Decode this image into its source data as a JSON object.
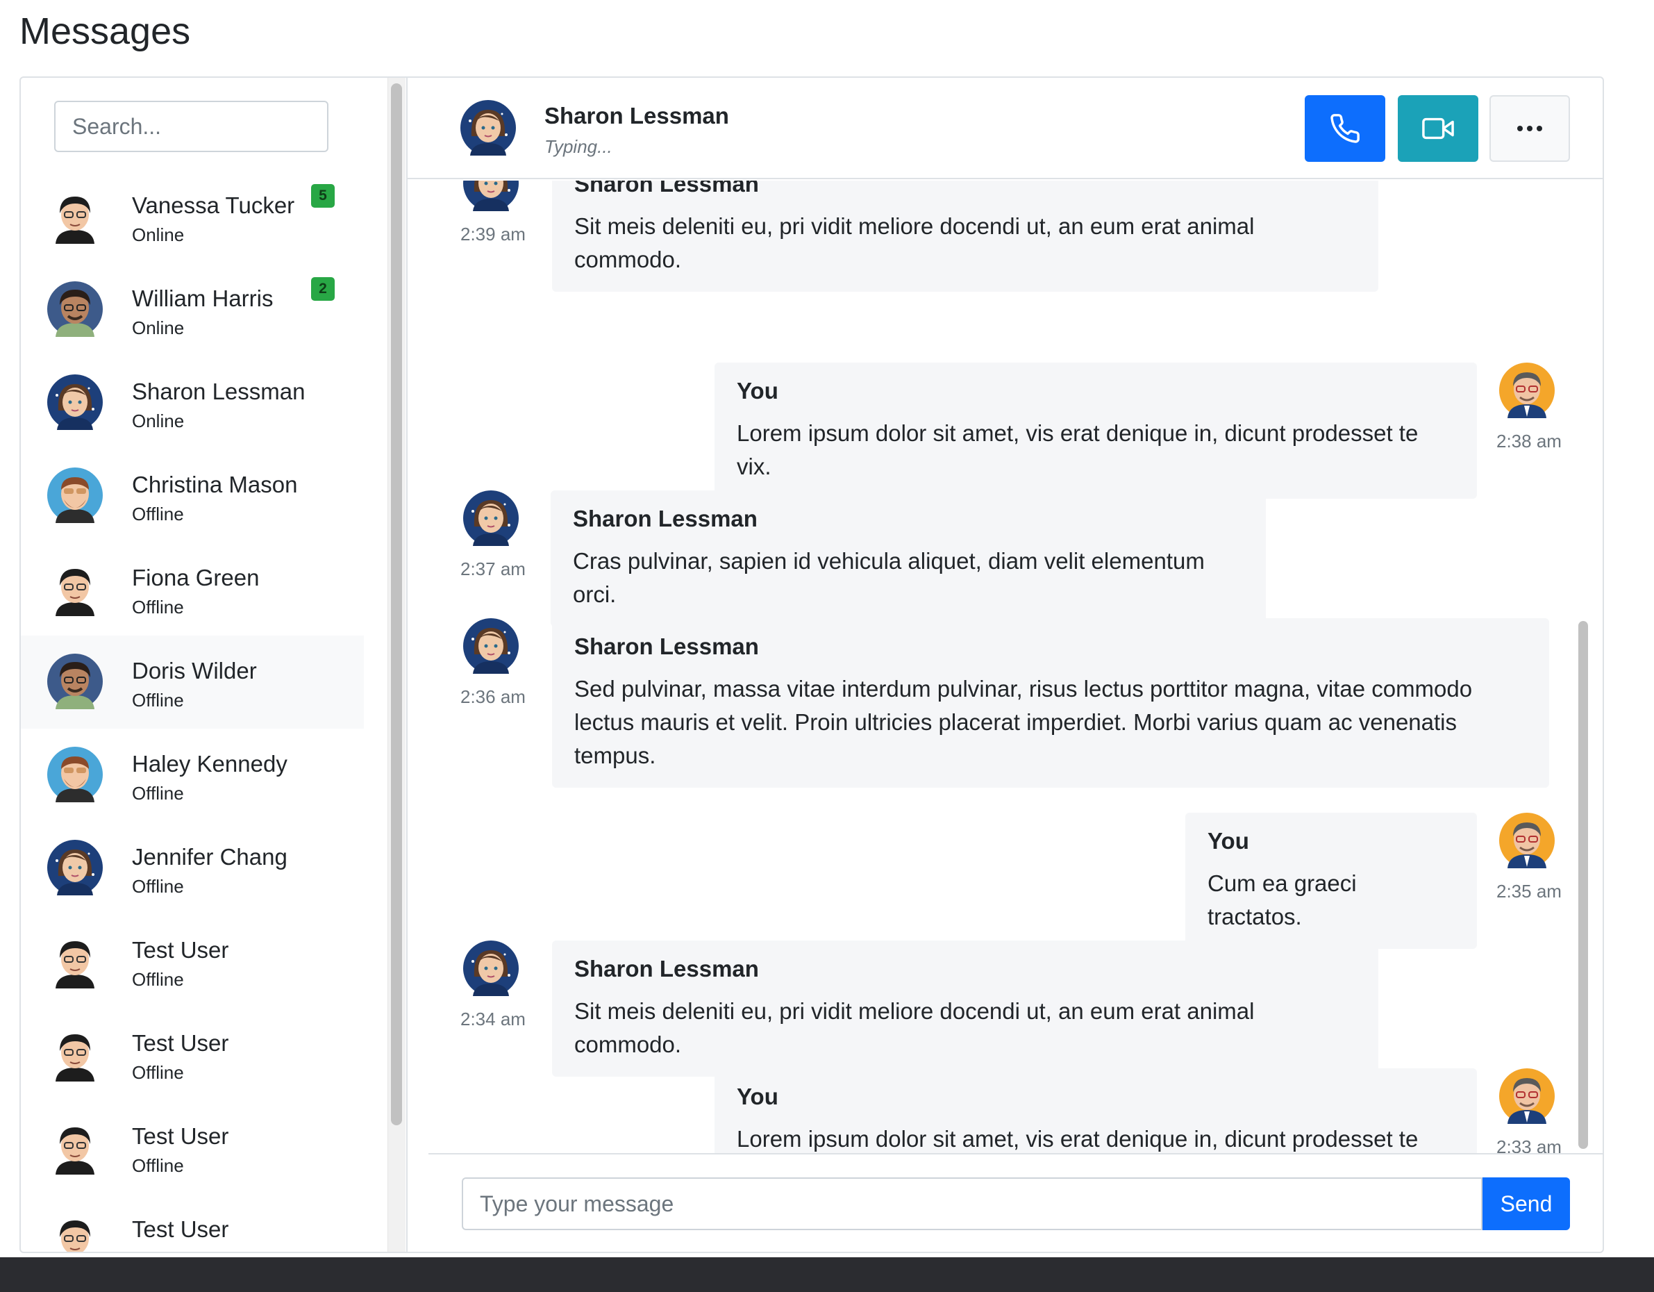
{
  "page": {
    "title": "Messages"
  },
  "search": {
    "placeholder": "Search..."
  },
  "contacts": [
    {
      "name": "Vanessa Tucker",
      "status": "Online",
      "badge": "5",
      "avatar": "avatar-dark-hair"
    },
    {
      "name": "William Harris",
      "status": "Online",
      "badge": "2",
      "avatar": "avatar-blue"
    },
    {
      "name": "Sharon Lessman",
      "status": "Online",
      "badge": "",
      "avatar": "avatar-woman"
    },
    {
      "name": "Christina Mason",
      "status": "Offline",
      "badge": "",
      "avatar": "avatar-beard"
    },
    {
      "name": "Fiona Green",
      "status": "Offline",
      "badge": "",
      "avatar": "avatar-dark-hair"
    },
    {
      "name": "Doris Wilder",
      "status": "Offline",
      "badge": "",
      "avatar": "avatar-blue"
    },
    {
      "name": "Haley Kennedy",
      "status": "Offline",
      "badge": "",
      "avatar": "avatar-beard"
    },
    {
      "name": "Jennifer Chang",
      "status": "Offline",
      "badge": "",
      "avatar": "avatar-woman"
    },
    {
      "name": "Test User",
      "status": "Offline",
      "badge": "",
      "avatar": "avatar-dark-hair"
    },
    {
      "name": "Test User",
      "status": "Offline",
      "badge": "",
      "avatar": "avatar-dark-hair"
    },
    {
      "name": "Test User",
      "status": "Offline",
      "badge": "",
      "avatar": "avatar-dark-hair"
    },
    {
      "name": "Test User",
      "status": "",
      "badge": "",
      "avatar": "avatar-dark-hair"
    }
  ],
  "chat": {
    "name": "Sharon Lessman",
    "status": "Typing...",
    "icons": {
      "call": "phone-icon",
      "video": "video-camera-icon",
      "more": "more-horizontal-icon"
    },
    "messages": [
      {
        "from": "Sharon Lessman",
        "side": "left",
        "time": "2:39 am",
        "text": "Sit meis deleniti eu, pri vidit meliore docendi ut, an eum erat animal commodo."
      },
      {
        "from": "You",
        "side": "right",
        "time": "2:38 am",
        "text": "Lorem ipsum dolor sit amet, vis erat denique in, dicunt prodesset te vix."
      },
      {
        "from": "Sharon Lessman",
        "side": "left",
        "time": "2:37 am",
        "text": "Cras pulvinar, sapien id vehicula aliquet, diam velit elementum orci."
      },
      {
        "from": "Sharon Lessman",
        "side": "left",
        "time": "2:36 am",
        "text": "Sed pulvinar, massa vitae interdum pulvinar, risus lectus porttitor magna, vitae commodo lectus mauris et velit. Proin ultricies placerat imperdiet. Morbi varius quam ac venenatis tempus."
      },
      {
        "from": "You",
        "side": "right",
        "time": "2:35 am",
        "text": "Cum ea graeci tractatos."
      },
      {
        "from": "Sharon Lessman",
        "side": "left",
        "time": "2:34 am",
        "text": "Sit meis deleniti eu, pri vidit meliore docendi ut, an eum erat animal commodo."
      },
      {
        "from": "You",
        "side": "right",
        "time": "2:33 am",
        "text": "Lorem ipsum dolor sit amet, vis erat denique in, dicunt prodesset te vix."
      }
    ]
  },
  "composer": {
    "placeholder": "Type your message",
    "send_label": "Send"
  },
  "colors": {
    "primary": "#0d6efd",
    "info": "#1ba2b8",
    "success": "#28a745",
    "bubble": "#f5f6f8"
  }
}
